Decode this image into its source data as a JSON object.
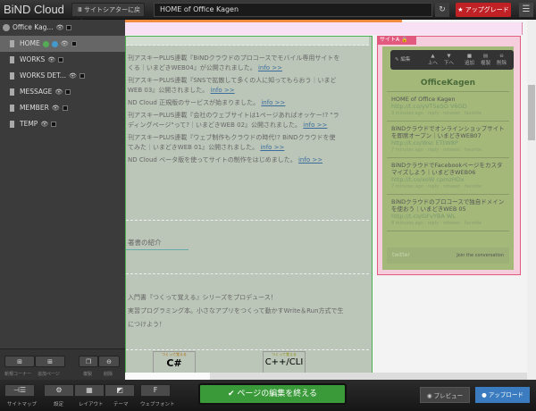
{
  "topbar": {
    "logo": "BiND Cloud",
    "back": "Ⅲ サイトシアターに戻る",
    "title": "HOME of Office Kagen",
    "refresh": "↻",
    "upgrade": "★ アップグレード",
    "menu": "☰"
  },
  "sidebar": {
    "root": "Office Kag...",
    "pages": [
      "HOME",
      "WORKS",
      "WORKS DET...",
      "MESSAGE",
      "MEMBER",
      "TEMP"
    ],
    "tools": {
      "new_corner": "新規コーナー",
      "new_page": "追加ページ",
      "duplicate": "複製",
      "delete": "削除"
    }
  },
  "content": {
    "news": [
      {
        "text": "刊アスキーPLUS連載『BiNDクラウドのプロコースでモバイル専用サイトを",
        "text2": "くる｜いまどきWEB04』が公開されました。",
        "link": "info >>"
      },
      {
        "text": "刊アスキーPLUS連載『SNSで拡散して多くの人に知ってもらおう｜いまど",
        "text2": "WEB 03』公開されました。",
        "link": "info >>"
      },
      {
        "text": "ND Cloud 正規版のサービスが始まりました。",
        "text2": "",
        "link": "info >>"
      },
      {
        "text": "刊アスキーPLUS連載『会社のウェブサイトは1ページあればオッケー!? \"ラ",
        "text2": "ディングページ\"って?｜いまどきWEB 02』公開されました。",
        "link": "info >>"
      },
      {
        "text": "刊アスキーPLUS連載『ウェブ制作もクラウドの時代!? BiNDクラウドを使",
        "text2": "てみた｜いまどきWEB 01』公開されました。",
        "link": "info >>"
      },
      {
        "text": "ND Cloud ベータ版を使ってサイトの制作をはじめました。",
        "text2": "",
        "link": "info >>"
      }
    ],
    "section_title": "著書の紹介",
    "para": [
      "入門書『つくって覚える』シリーズをプロデュース！",
      "実習プログラミング本。小さなアプリをつくって動かすWrite＆Run方式で生",
      "につけよう！"
    ],
    "books": [
      "C#",
      "C++/CLI"
    ],
    "book_tag": "つくって覚える"
  },
  "site_a": {
    "label": "サイトA",
    "toolbar": [
      "編集",
      "上へ",
      "下へ",
      "追加",
      "複製",
      "削除"
    ],
    "account": "OfficeKagen",
    "tweets": [
      {
        "text": "HOME of Office Kagen ",
        "link": "http://t.co/yVT5eSO V6OD",
        "meta": "3 minutes ago · reply · retweet · favorite"
      },
      {
        "text": "BiNDクラウドでオンラインショップサイトを即席オープン｜いまどきWEB07 ",
        "link": "http://t.co/Wsc ETtW8P",
        "meta": "7 minutes ago · reply · retweet · favorite"
      },
      {
        "text": "BiNDクラウドでFacebookページをカスタマイズしよう｜いまどきWEB06 ",
        "link": "http://t.co/xoW cpmzHDx",
        "meta": "7 minutes ago · reply · retweet · favorite"
      },
      {
        "text": "BiNDクラウドのプロコースで独自ドメインを使おう｜いまどきWEB 05 ",
        "link": "http://t.co/GFvYBA WL",
        "meta": "8 minutes ago · reply · retweet · favorite"
      }
    ],
    "twitter": "twitter",
    "join": "Join the conversation"
  },
  "bottom": {
    "sitemap": "サイトマップ",
    "settings": "設定",
    "layout": "レイアウト",
    "theme": "テーマ",
    "webfont": "ウェブフォント",
    "finish": "✔ ページの編集を終える",
    "preview": "◉ プレビュー",
    "upload": "● アップロード"
  }
}
